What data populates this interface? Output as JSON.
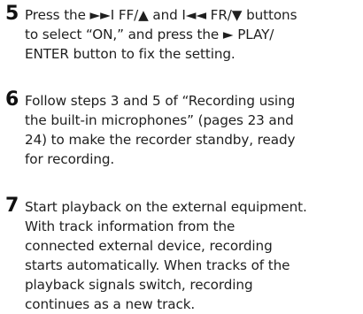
{
  "steps": [
    {
      "number": "5",
      "lines": [
        "Press the ►►I FF/▲ and I◄◄ FR/▼ buttons",
        "to select “ON,” and press the ► PLAY/",
        "ENTER button to fix the setting."
      ]
    },
    {
      "number": "6",
      "lines": [
        "Follow steps 3 and 5 of “Recording using",
        "the built-in microphones” (pages 23 and",
        "24) to make the recorder standby, ready",
        "for recording."
      ]
    },
    {
      "number": "7",
      "lines": [
        "Start playback on the external equipment.",
        "With track information from the",
        "connected external device, recording",
        "starts automatically. When tracks of the",
        "playback signals switch, recording",
        "continues as a new track."
      ]
    }
  ]
}
